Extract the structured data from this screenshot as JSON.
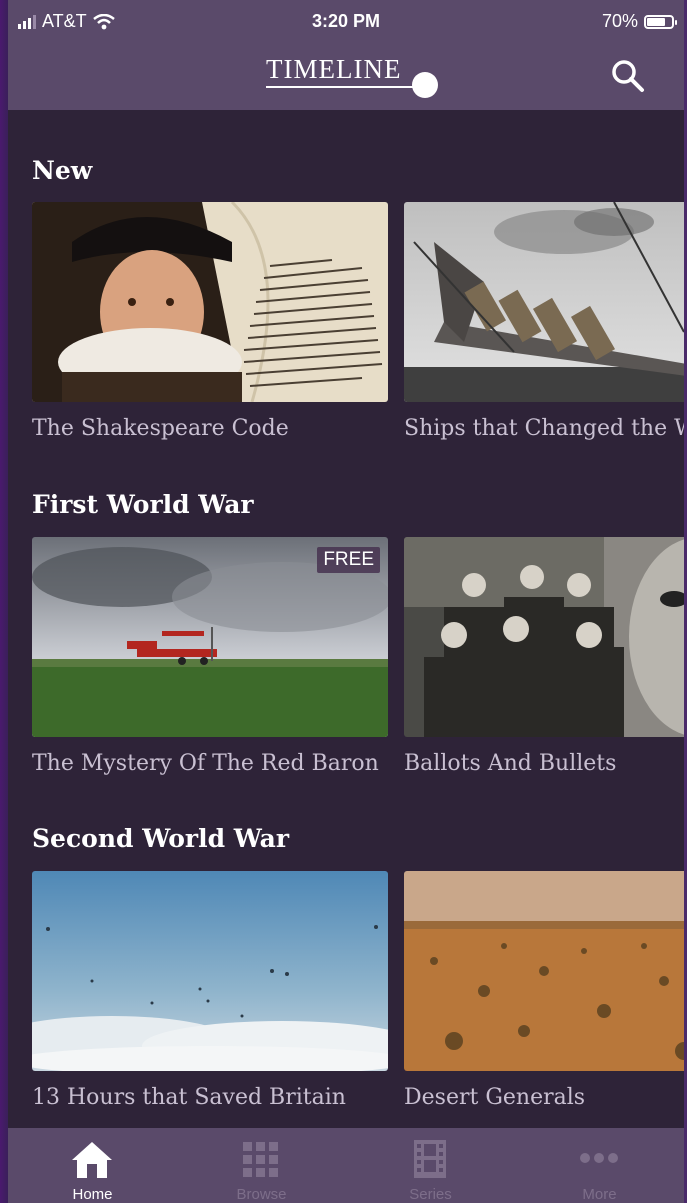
{
  "status_bar": {
    "carrier": "AT&T",
    "time": "3:20 PM",
    "battery": "70%"
  },
  "header": {
    "logo": "TIMELINE"
  },
  "sections": [
    {
      "title": "New",
      "items": [
        {
          "title": "The Shakespeare Code"
        },
        {
          "title": "Ships that Changed the World"
        }
      ]
    },
    {
      "title": "First World War",
      "items": [
        {
          "title": "The Mystery Of The Red Baron",
          "badge": "FREE"
        },
        {
          "title": "Ballots And Bullets"
        }
      ]
    },
    {
      "title": "Second World War",
      "items": [
        {
          "title": "13 Hours that Saved Britain"
        },
        {
          "title": "Desert Generals"
        }
      ]
    }
  ],
  "tabs": [
    {
      "label": "Home",
      "icon": "home-icon",
      "active": true
    },
    {
      "label": "Browse",
      "icon": "grid-icon",
      "active": false
    },
    {
      "label": "Series",
      "icon": "film-icon",
      "active": false
    },
    {
      "label": "More",
      "icon": "more-icon",
      "active": false
    }
  ],
  "colors": {
    "bar": "#5a4a6a",
    "background": "#2e2338",
    "tab_active": "#ffffff",
    "tab_inactive": "#7d6e8a"
  }
}
